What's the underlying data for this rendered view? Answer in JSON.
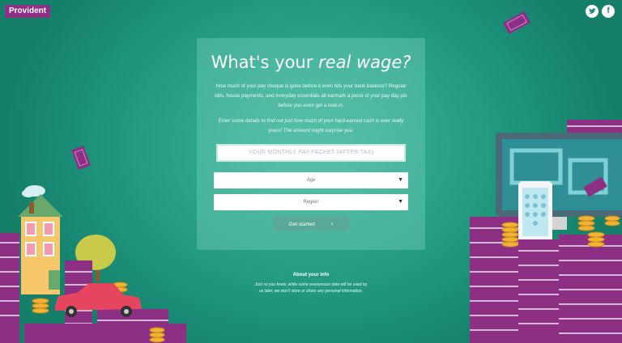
{
  "brand": {
    "name": "Provident"
  },
  "social": {
    "twitter": "twitter-icon",
    "facebook": "f"
  },
  "panel": {
    "title_plain": "What's your ",
    "title_emph": "real wage?",
    "intro": "How much of your pay cheque is gone before it even hits your bank balance? Regular bills, house payments, and everyday essentials all earmark a piece of your pay day pie before you even get a look in.",
    "intro2": "Enter some details to find out just how much of your hard-earned cash is ever really yours! The amount might surprise you.",
    "pay_placeholder": "YOUR MONTHLY PAY-PACKET (AFTER TAX)",
    "age_label": "Age",
    "region_label": "Region",
    "start_label": "Get started",
    "arrow": "▼",
    "chevron": "›"
  },
  "about": {
    "title": "About your info",
    "text": "Just so you know, while some anonymous data will be used by us later, we won't store or share any personal information."
  },
  "colors": {
    "background": "#2aa58a",
    "brand_purple": "#8e2f86",
    "button": "#58a997"
  }
}
